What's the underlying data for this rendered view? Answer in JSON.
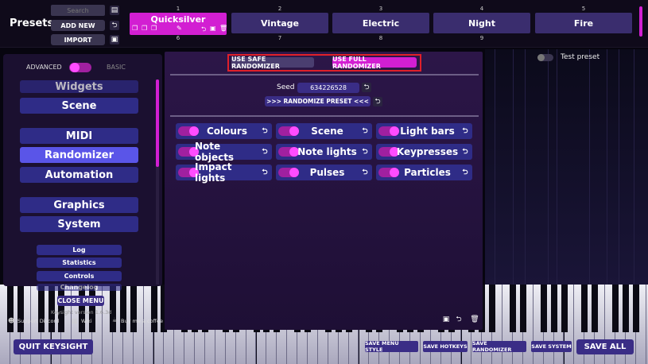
{
  "presets": {
    "title": "Presets",
    "search_placeholder": "Search",
    "add_new_label": "ADD NEW",
    "import_label": "IMPORT",
    "slots_row1": [
      {
        "number": "1",
        "name": "Quicksilver"
      },
      {
        "number": "2",
        "name": "Vintage"
      },
      {
        "number": "3",
        "name": "Electric"
      },
      {
        "number": "4",
        "name": "Night"
      },
      {
        "number": "5",
        "name": "Fire"
      }
    ],
    "slots_row2_numbers": [
      "6",
      "7",
      "8",
      "9"
    ]
  },
  "sidebar": {
    "advanced_label": "ADVANCED",
    "basic_label": "BASIC",
    "nav_items": [
      "Widgets",
      "Scene",
      "MIDI",
      "Randomizer",
      "Automation",
      "Graphics",
      "System"
    ],
    "sub_items": [
      "Log",
      "Statistics",
      "Controls",
      "Changelog"
    ],
    "close_menu_label": "CLOSE MENU",
    "version": "Keysight version 1.6.3d",
    "links": {
      "discord": "Support Discord",
      "wiki": "Wiki",
      "coffee": "Buy me a coffee"
    }
  },
  "randomizer": {
    "safe_label": "USE SAFE RANDOMIZER",
    "full_label": "USE FULL RANDOMIZER",
    "seed_label": "Seed",
    "seed_value": "634226528",
    "randomize_label": ">>> RANDOMIZE PRESET <<<",
    "categories": [
      "Colours",
      "Scene",
      "Light bars",
      "Note objects",
      "Note lights",
      "Keypresses",
      "Impact lights",
      "Pulses",
      "Particles"
    ]
  },
  "test_preset_label": "Test preset",
  "bottom": {
    "quit_label": "QUIT KEYSIGHT",
    "save_menu_style": "SAVE MENU STYLE",
    "save_hotkeys": "SAVE HOTKEYS",
    "save_randomizer": "SAVE RANDOMIZER",
    "save_system": "SAVE SYSTEM",
    "save_all": "SAVE ALL"
  },
  "colors": {
    "accent": "#d21fd2",
    "button": "#2f2c87",
    "highlight_box": "#e0202a"
  }
}
